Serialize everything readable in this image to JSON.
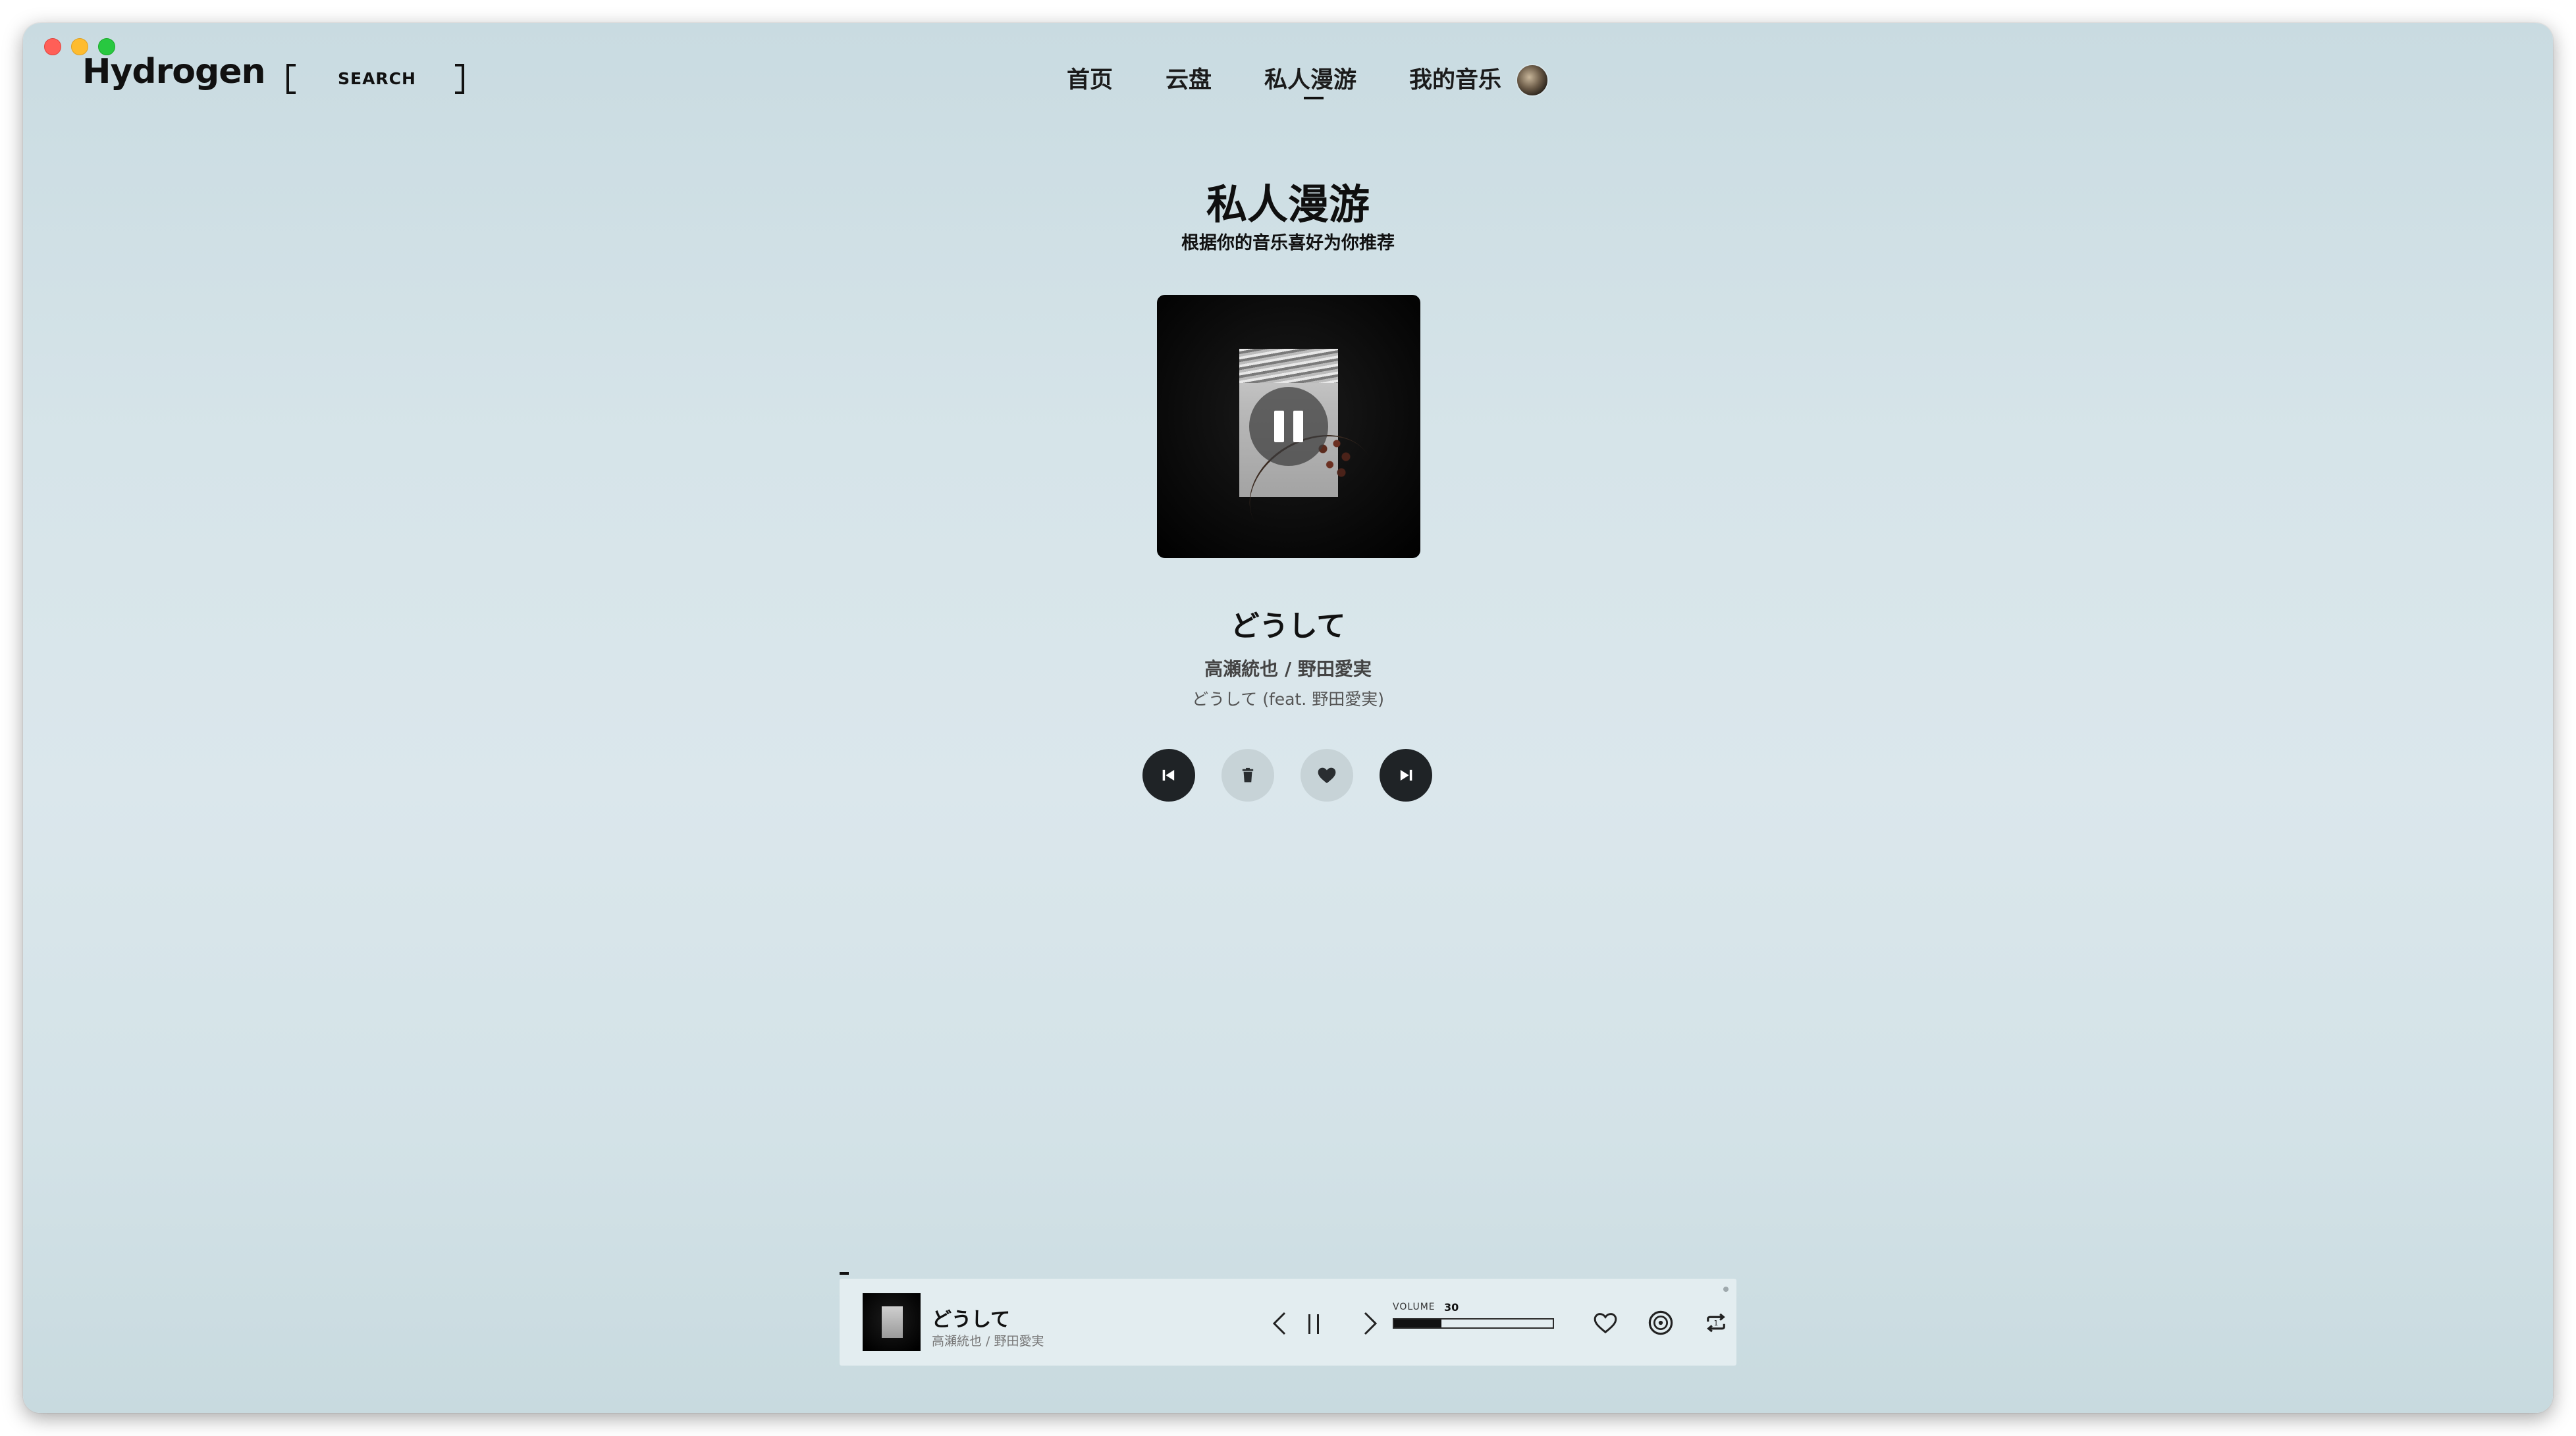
{
  "app": {
    "name": "Hydrogen"
  },
  "search": {
    "label": "SEARCH"
  },
  "nav": {
    "items": [
      "首页",
      "云盘",
      "私人漫游",
      "我的音乐"
    ],
    "active": "私人漫游"
  },
  "page": {
    "title": "私人漫游",
    "subtitle": "根据你的音乐喜好为你推荐"
  },
  "track": {
    "title": "どうして",
    "artists": "高瀬統也 / 野田愛実",
    "album": "どうして (feat. 野田愛実)",
    "state": "playing"
  },
  "fm_controls": {
    "icons": [
      "skip-previous-icon",
      "trash-icon",
      "heart-icon",
      "skip-next-icon"
    ]
  },
  "player": {
    "title": "どうして",
    "artists": "高瀬統也 / 野田愛実",
    "volume_label": "VOLUME",
    "volume_value": "30",
    "volume_fraction": 0.3
  },
  "colors": {
    "background": "#d6e4e9",
    "accent": "#111111",
    "player_bg": "#e3edf0"
  }
}
